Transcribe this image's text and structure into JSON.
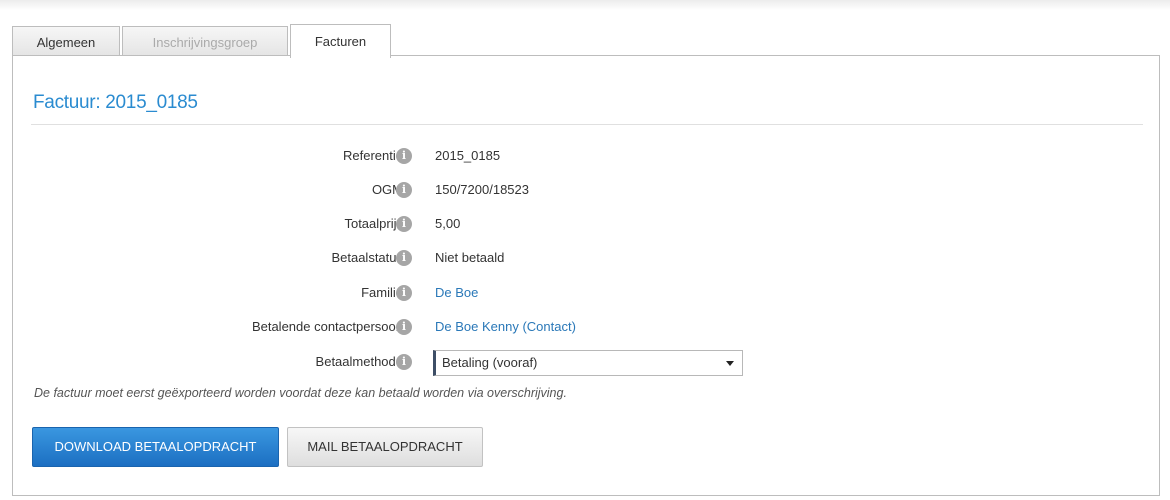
{
  "tabs": [
    {
      "label": "Algemeen",
      "state": "normal"
    },
    {
      "label": "Inschrijvingsgroep",
      "state": "disabled"
    },
    {
      "label": "Facturen",
      "state": "active"
    }
  ],
  "invoice": {
    "title": "Factuur: 2015_0185",
    "fields": [
      {
        "label": "Referentie",
        "value": "2015_0185",
        "link": false
      },
      {
        "label": "OGM",
        "value": "150/7200/18523",
        "link": false
      },
      {
        "label": "Totaalprijs",
        "value": "5,00",
        "link": false
      },
      {
        "label": "Betaalstatus",
        "value": "Niet betaald",
        "link": false
      },
      {
        "label": "Familie",
        "value": "De Boe",
        "link": true
      },
      {
        "label": "Betalende contactpersoon",
        "value": "De Boe Kenny (Contact)",
        "link": true
      }
    ],
    "payment_method": {
      "label": "Betaalmethode",
      "selected": "Betaling (vooraf)"
    },
    "note": "De factuur moet eerst geëxporteerd worden voordat deze kan betaald worden via overschrijving."
  },
  "actions": {
    "download": "DOWNLOAD BETAALOPDRACHT",
    "mail": "MAIL BETAALOPDRACHT"
  },
  "icons": {
    "info": "info-circle-icon",
    "dropdown": "caret-down-icon"
  },
  "colors": {
    "title": "#2a8bd0",
    "link": "#2a78b8",
    "primary_button": "#1c6fc2"
  }
}
